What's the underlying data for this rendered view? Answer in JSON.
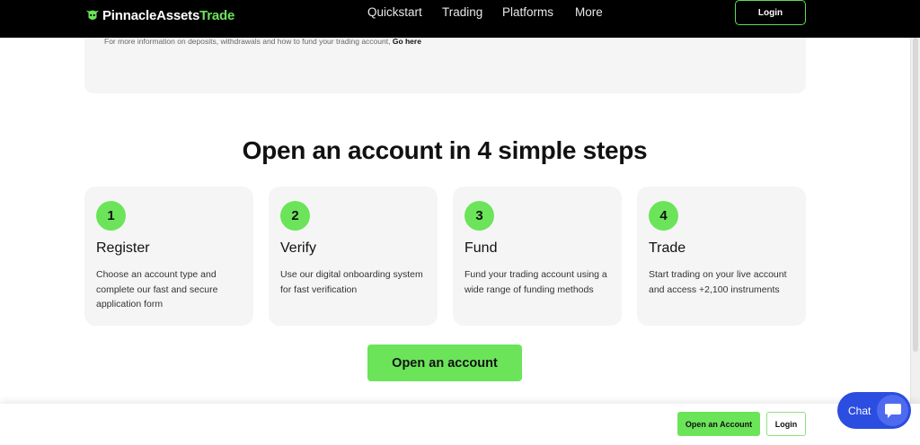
{
  "header": {
    "logo_part1": "PinnacleAssets",
    "logo_part2": "Trade",
    "nav": [
      "Quickstart",
      "Trading",
      "Platforms",
      "More"
    ],
    "login_label": "Login"
  },
  "info": {
    "text": "For more information on deposits, withdrawals and how to fund your trading account,",
    "link": "Go here"
  },
  "headline": "Open an account in 4 simple steps",
  "steps": [
    {
      "num": "1",
      "title": "Register",
      "desc": "Choose an account type and complete our fast and secure application form"
    },
    {
      "num": "2",
      "title": "Verify",
      "desc": "Use our digital onboarding system for fast verification"
    },
    {
      "num": "3",
      "title": "Fund",
      "desc": "Fund your trading account using a wide range of funding methods"
    },
    {
      "num": "4",
      "title": "Trade",
      "desc": "Start trading on your live account and access +2,100 instruments"
    }
  ],
  "cta_label": "Open an account",
  "bottom_bar": {
    "open_label": "Open an Account",
    "login_label": "Login"
  },
  "chat": {
    "label": "Chat"
  },
  "colors": {
    "accent": "#6be45a",
    "header_bg": "#000000",
    "chat_bg": "#2b4de0"
  }
}
